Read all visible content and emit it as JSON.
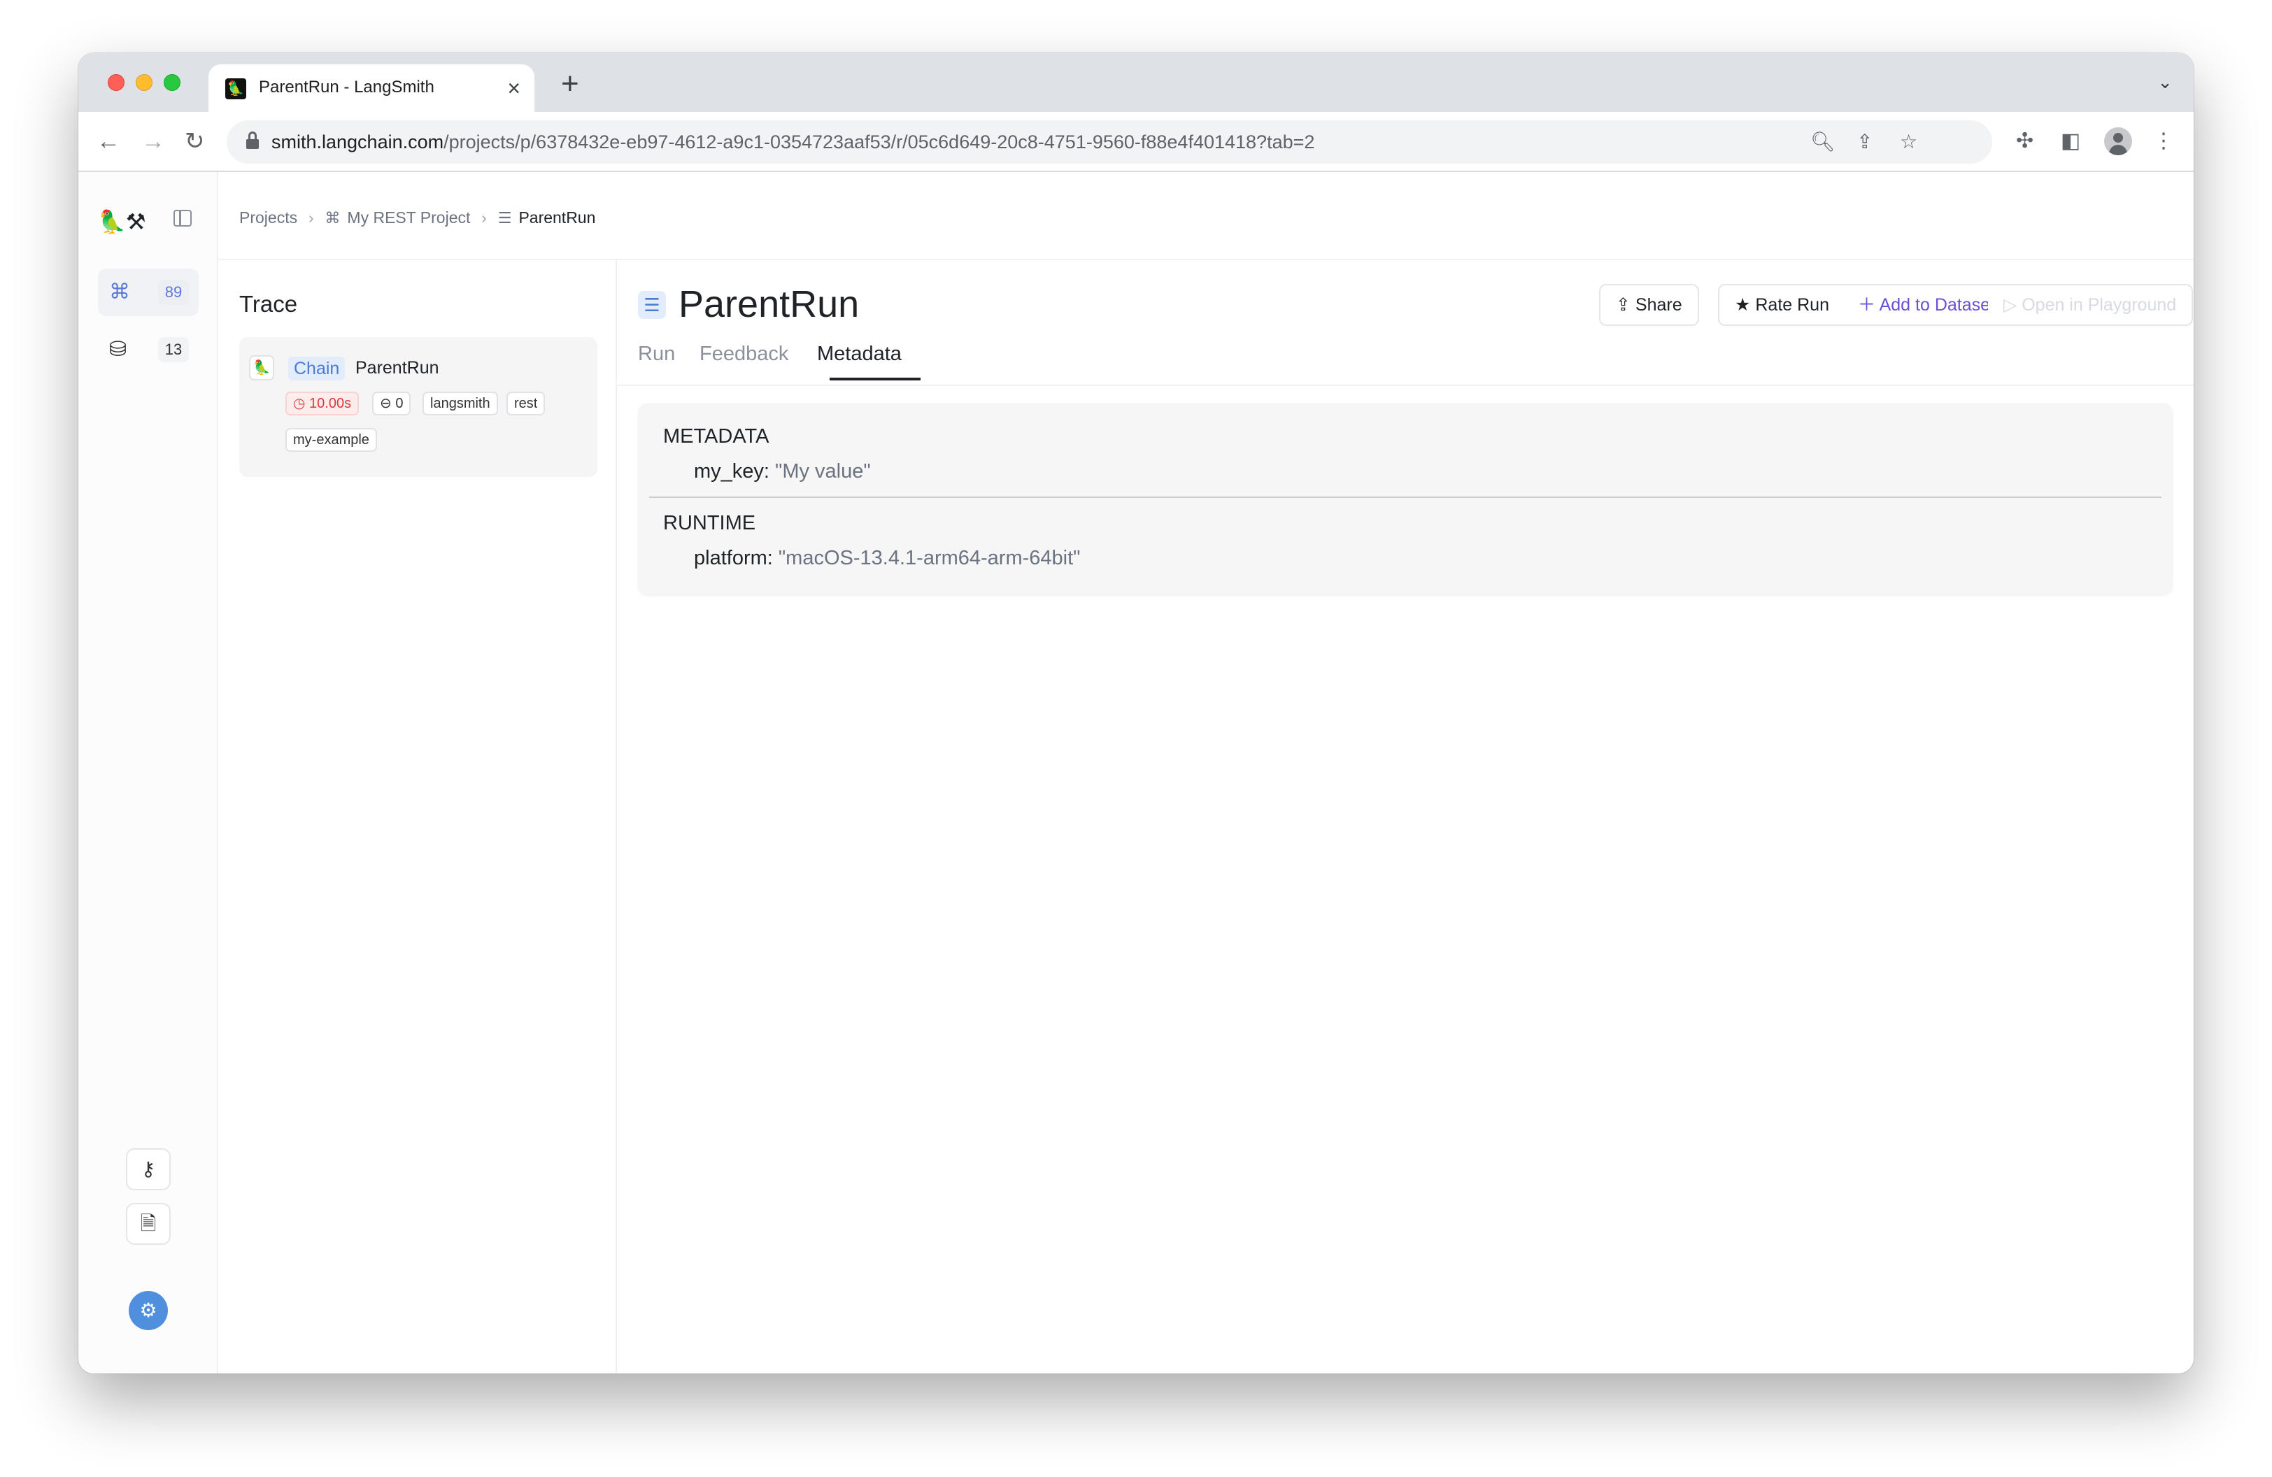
{
  "browser": {
    "tab_title": "ParentRun - LangSmith",
    "url_host": "smith.langchain.com",
    "url_path": "/projects/p/6378432e-eb97-4612-a9c1-0354723aaf53/r/05c6d649-20c8-4751-9560-f88e4f401418?tab=2"
  },
  "rail": {
    "projects_count": "89",
    "datasets_count": "13"
  },
  "breadcrumb": {
    "projects": "Projects",
    "project": "My REST Project",
    "run": "ParentRun"
  },
  "trace": {
    "title": "Trace",
    "run_type": "Chain",
    "run_name": "ParentRun",
    "latency": "10.00s",
    "tokens": "0",
    "tags": [
      "langsmith",
      "rest",
      "my-example"
    ]
  },
  "detail": {
    "title": "ParentRun",
    "buttons": {
      "share": "Share",
      "rate": "Rate Run",
      "add": "Add to Dataset",
      "playground": "Open in Playground"
    },
    "tabs": [
      "Run",
      "Feedback",
      "Metadata"
    ],
    "active_tab": "Metadata"
  },
  "metadata": {
    "section1": "METADATA",
    "key1": "my_key:",
    "val1": "\"My value\"",
    "section2": "RUNTIME",
    "key2": "platform:",
    "val2": "\"macOS-13.4.1-arm64-arm-64bit\""
  },
  "colors": {
    "accent_blue": "#4a7bd3",
    "accent_purple": "#6b4fd6",
    "latency_red": "#dc3b3b"
  }
}
